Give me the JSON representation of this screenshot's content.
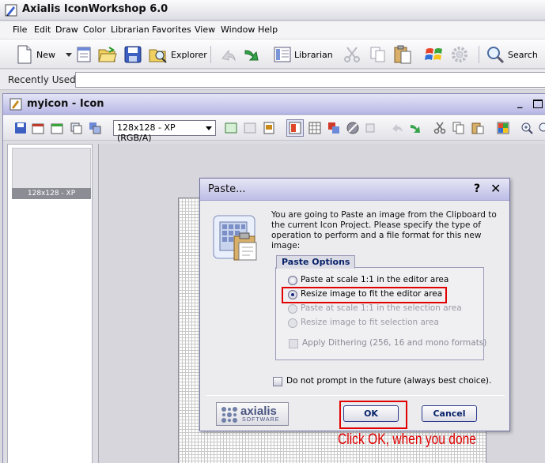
{
  "app": {
    "title": "Axialis IconWorkshop 6.0"
  },
  "menu": [
    "File",
    "Edit",
    "Draw",
    "Color",
    "Librarian",
    "Favorites",
    "View",
    "Window",
    "Help"
  ],
  "toolbar": {
    "new_label": "New",
    "explorer_label": "Explorer",
    "librarian_label": "Librarian",
    "search_label": "Search"
  },
  "recent": {
    "label": "Recently Used",
    "value": ""
  },
  "document": {
    "title": "myicon - Icon",
    "format_selected": "128x128 - XP (RGB/A)",
    "thumbnail_label": "128x128 - XP"
  },
  "dialog": {
    "title": "Paste...",
    "help": "?",
    "close": "✕",
    "message": "You are going to Paste an image from the Clipboard to the current Icon Project. Please specify the type of operation to perform and a file format for this new image:",
    "group_title": "Paste Options",
    "options": [
      {
        "label": "Paste at scale 1:1 in the editor area",
        "selected": false,
        "enabled": true
      },
      {
        "label": "Resize image to fit the editor area",
        "selected": true,
        "enabled": true
      },
      {
        "label": "Paste at scale 1:1 in the selection area",
        "selected": false,
        "enabled": false
      },
      {
        "label": "Resize image to fit selection area",
        "selected": false,
        "enabled": false
      }
    ],
    "dithering_label": "Apply Dithering (256, 16 and mono formats)",
    "no_prompt_label": "Do not prompt in the future (always best choice).",
    "logo_text": "axialis",
    "logo_sub": "SOFTWARE",
    "ok_label": "OK",
    "cancel_label": "Cancel"
  },
  "annotation": {
    "text": "Click OK, when you done",
    "color": "#e00000"
  },
  "colors": {
    "accent_red": "#e00000",
    "title_blue": "#0a246a"
  }
}
